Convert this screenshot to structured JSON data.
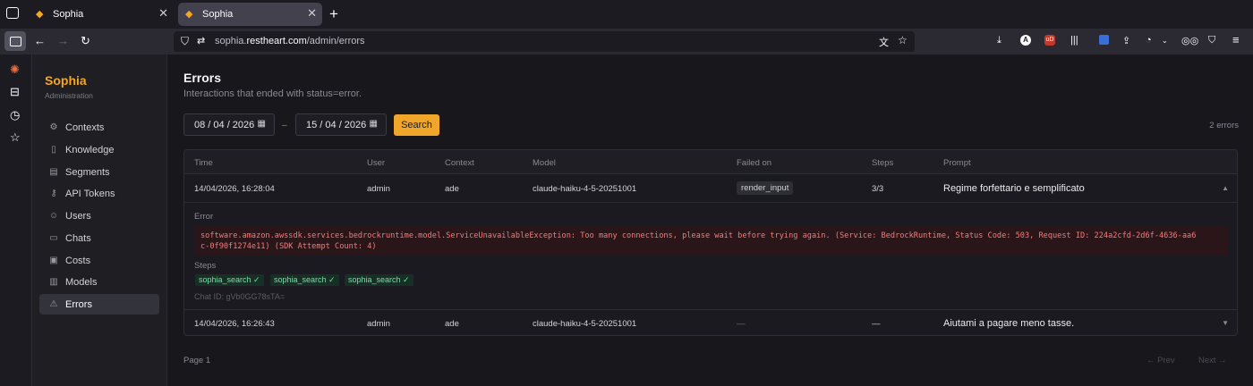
{
  "browser": {
    "tabs": [
      {
        "title": "Sophia"
      },
      {
        "title": "Sophia"
      }
    ],
    "url_prefix": "sophia.",
    "url_domain": "restheart.com",
    "url_path": "/admin/errors"
  },
  "app": {
    "brand": "Sophia",
    "brand_sub": "Administration",
    "nav": [
      {
        "label": "Contexts",
        "icon": "gear-icon"
      },
      {
        "label": "Knowledge",
        "icon": "book-icon"
      },
      {
        "label": "Segments",
        "icon": "layers-icon"
      },
      {
        "label": "API Tokens",
        "icon": "key-icon"
      },
      {
        "label": "Users",
        "icon": "users-icon"
      },
      {
        "label": "Chats",
        "icon": "chat-icon"
      },
      {
        "label": "Costs",
        "icon": "dollar-icon"
      },
      {
        "label": "Models",
        "icon": "bar-chart-icon"
      },
      {
        "label": "Errors",
        "icon": "warning-icon",
        "active": true
      }
    ]
  },
  "page": {
    "title": "Errors",
    "subtitle": "Interactions that ended with status=error.",
    "date_from": "08 / 04 / 2026",
    "date_to": "15 / 04 / 2026",
    "dash": "–",
    "search_label": "Search",
    "count": "2 errors",
    "columns": [
      "Time",
      "User",
      "Context",
      "Model",
      "Failed on",
      "Steps",
      "Prompt"
    ],
    "rows": [
      {
        "time": "14/04/2026, 16:28:04",
        "user": "admin",
        "context": "ade",
        "model": "claude-haiku-4-5-20251001",
        "failed_on": "render_input",
        "steps": "3/3",
        "prompt": "Regime forfettario e semplificato",
        "expanded": true,
        "chevron": "▲"
      },
      {
        "time": "14/04/2026, 16:26:43",
        "user": "admin",
        "context": "ade",
        "model": "claude-haiku-4-5-20251001",
        "failed_on": "—",
        "steps": "—",
        "prompt": "Aiutami a pagare meno tasse.",
        "expanded": false,
        "chevron": "▼"
      }
    ],
    "detail": {
      "error_label": "Error",
      "error_line1": "software.amazon.awssdk.services.bedrockruntime.model.ServiceUnavailableException: Too many connections, please wait before trying again. (Service: BedrockRuntime, Status Code: 503, Request ID: 224a2cfd-2d6f-4636-aa6",
      "error_line2": "c-0f90f1274e11) (SDK Attempt Count: 4)",
      "steps_label": "Steps",
      "steps": [
        "sophia_search ✓",
        "sophia_search ✓",
        "sophia_search ✓"
      ],
      "chat_id": "Chat ID: gVb0GG78sTA="
    },
    "pager": {
      "page": "Page 1",
      "prev": "← Prev",
      "next": "Next →"
    }
  }
}
